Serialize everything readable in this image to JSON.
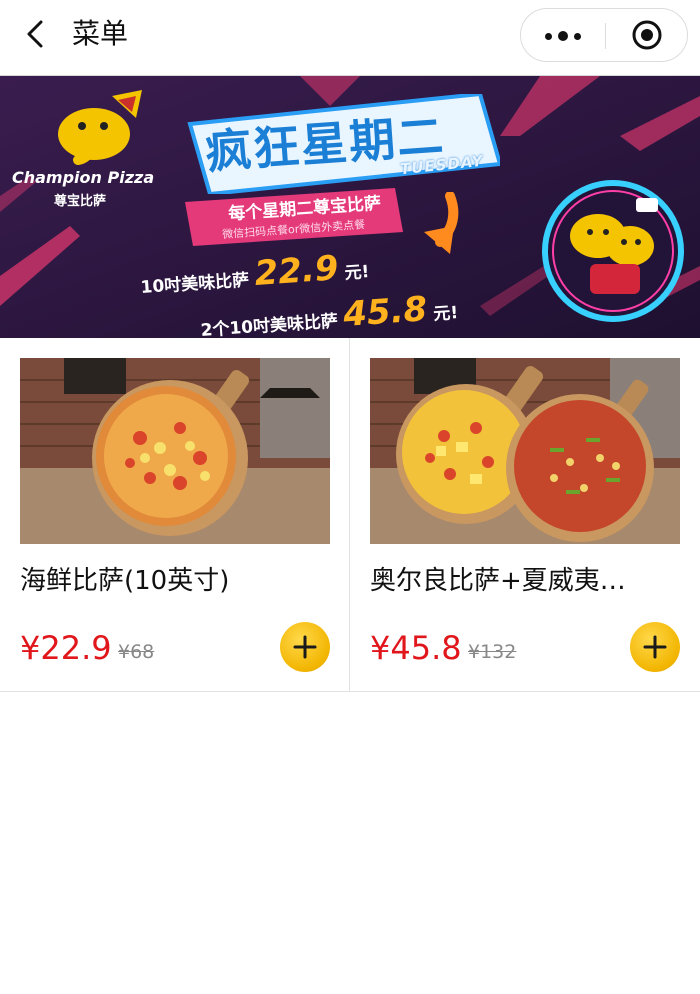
{
  "header": {
    "title": "菜单",
    "back_icon": "chevron-left-icon",
    "more_icon": "more-dots-icon",
    "target_icon": "target-circle-icon"
  },
  "banner": {
    "logo_text": "Champion Pizza",
    "logo_sub": "尊宝比萨",
    "headline": "疯狂星期二",
    "tag": "TUESDAY",
    "slogan": "每个星期二尊宝比萨",
    "sub_slogan": "微信扫码点餐or微信外卖点餐",
    "offer1_prefix": "10吋美味比萨",
    "offer1_price": "22.9",
    "offer1_suffix": "元!",
    "offer2_prefix": "2个10吋美味比萨",
    "offer2_price": "45.8",
    "offer2_suffix": "元!"
  },
  "products": [
    {
      "name": "海鲜比萨(10英寸)",
      "price": "¥22.9",
      "original_price": "¥68",
      "add_icon": "plus-icon"
    },
    {
      "name": "奥尔良比萨+夏威夷…",
      "price": "¥45.8",
      "original_price": "¥132",
      "add_icon": "plus-icon"
    }
  ],
  "colors": {
    "price": "#e0161b",
    "add_button": "#f2b500",
    "banner_bg": "#2b1840",
    "headline_blue": "#1c7fd6"
  }
}
